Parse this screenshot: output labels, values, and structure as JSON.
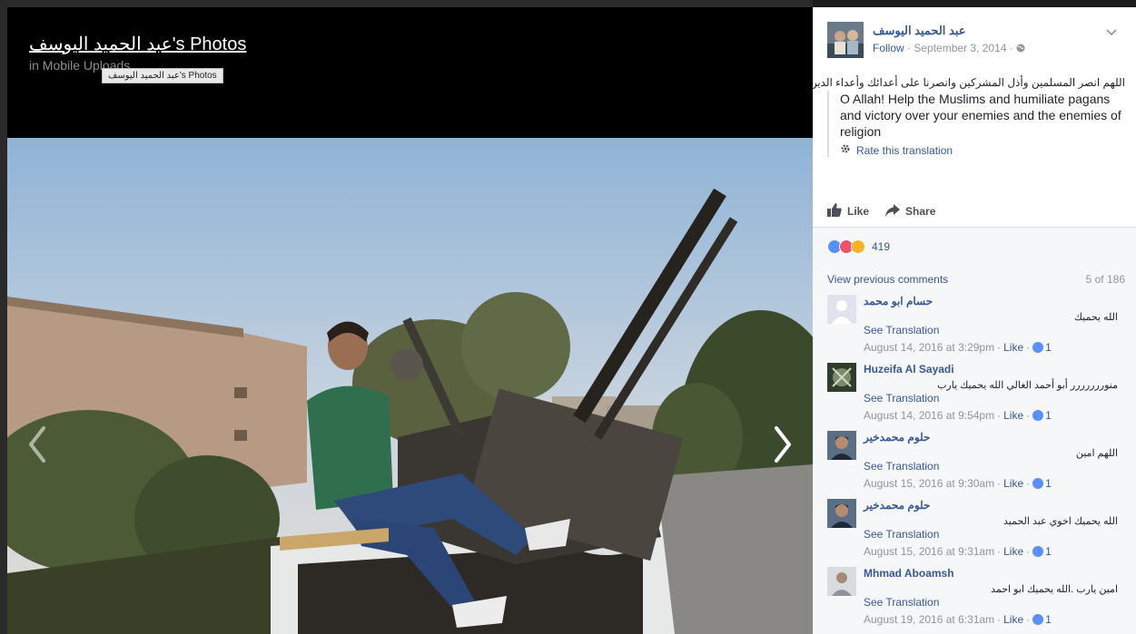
{
  "viewer": {
    "album_title": "عبد الحميد اليوسف's Photos",
    "album_subtitle": "in Mobile Uploads",
    "tooltip": "عبد الحميد اليوسف's Photos"
  },
  "post": {
    "author": "عبد الحميد اليوسف",
    "follow_label": "Follow",
    "separator": " · ",
    "date": "September 3, 2014",
    "text_arabic": "اللهم انصر المسلمين وأذل المشركين وانصرنا على أعدائك وأعداء الدين",
    "translation": "O Allah! Help the Muslims and humiliate pagans and victory over your enemies and the enemies of religion",
    "rate_translation": "Rate this translation",
    "like_label": "Like",
    "share_label": "Share",
    "reaction_count": "419"
  },
  "comments_section": {
    "view_previous": "View previous comments",
    "count": "5 of 186",
    "see_translation": "See Translation",
    "like_label": "Like",
    "items": [
      {
        "name": "حسام ابو محمد",
        "text": "الله يحميك",
        "time": "August 14, 2016 at 3:29pm",
        "likes": "1"
      },
      {
        "name": "Huzeifa Al Sayadi",
        "text": "منوررررررر أبو أحمد الغالي الله يحميك يارب",
        "time": "August 14, 2016 at 9:54pm",
        "likes": "1"
      },
      {
        "name": "حلوم محمدخير",
        "text": "اللهم امين",
        "time": "August 15, 2016 at 9:30am",
        "likes": "1"
      },
      {
        "name": "حلوم محمدخير",
        "text": "الله يحميك اخوي عبد الحميد",
        "time": "August 15, 2016 at 9:31am",
        "likes": "1"
      },
      {
        "name": "Mhmad Aboamsh",
        "text": "امين يارب .الله يحميك ابو احمد",
        "time": "August 19, 2016 at 6:31am",
        "likes": "1"
      }
    ]
  },
  "colors": {
    "link": "#365899",
    "muted": "#90949c",
    "like_blue": "#5890ff",
    "love_red": "#f25268",
    "angry_orange": "#f7b125"
  },
  "icons": [
    "chevron-left-icon",
    "chevron-right-icon",
    "globe-icon",
    "gear-icon",
    "thumbs-up-icon",
    "share-arrow-icon",
    "chevron-down-icon"
  ]
}
